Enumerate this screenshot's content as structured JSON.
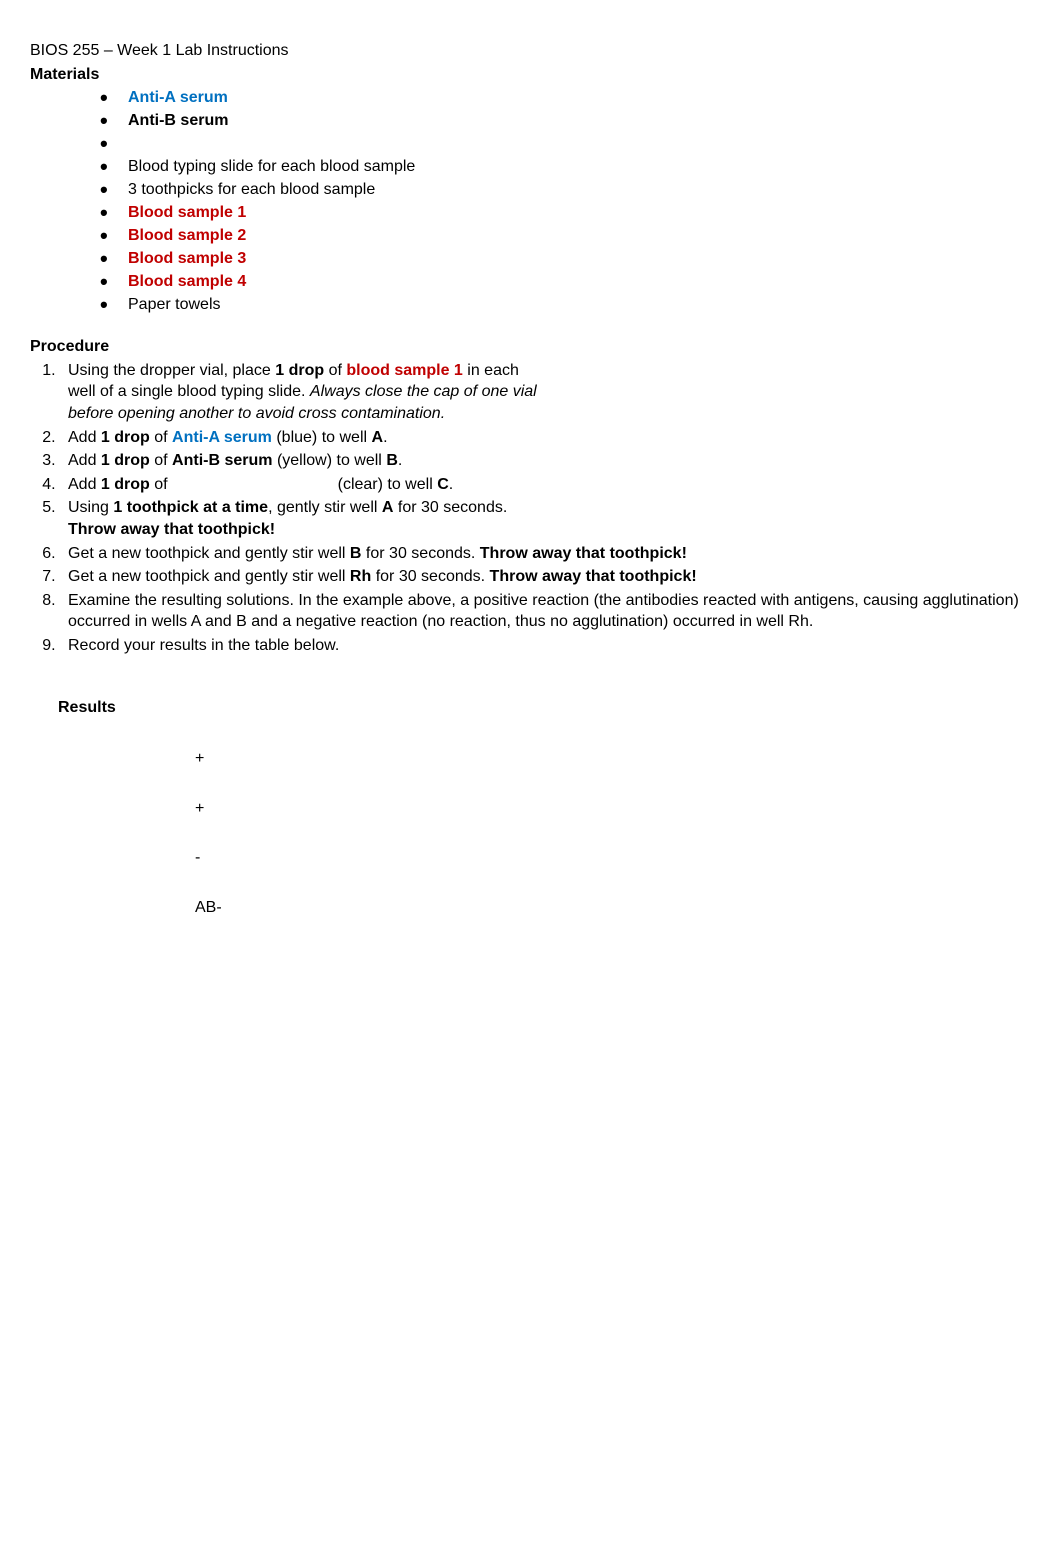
{
  "header": {
    "title": "BIOS 255 – Week 1 Lab Instructions"
  },
  "materials": {
    "heading": "Materials",
    "items": {
      "anti_a": "Anti-A serum",
      "anti_b": "Anti-B serum",
      "blank": "",
      "slide": "Blood typing slide for each blood sample",
      "toothpicks": "3 toothpicks for each blood sample",
      "bs1": "Blood sample 1",
      "bs2": "Blood sample 2",
      "bs3": "Blood sample 3",
      "bs4": "Blood sample 4",
      "towels": "Paper towels"
    }
  },
  "procedure": {
    "heading": "Procedure",
    "step1": {
      "p1": "Using the dropper vial, place ",
      "bold1": "1 drop",
      "p2": " of ",
      "red1": "blood sample 1",
      "p3": " in each well of a single blood typing slide. ",
      "italic1": "Always close the cap of one vial before opening another to avoid cross contamination."
    },
    "step2": {
      "p1": "Add ",
      "bold1": "1 drop",
      "p2": " of ",
      "colored1": "Anti-A serum",
      "p3": " (blue) to well ",
      "bold2": "A",
      "p4": "."
    },
    "step3": {
      "p1": "Add ",
      "bold1": "1 drop",
      "p2": " of ",
      "bold2": "Anti-B serum",
      "p3": " (yellow) to well ",
      "bold3": "B",
      "p4": "."
    },
    "step4": {
      "p1": "Add ",
      "bold1": "1 drop",
      "p2": " of",
      "p3": "(clear) to well ",
      "bold2": "C",
      "p4": "."
    },
    "step5": {
      "p1": "Using ",
      "bold1": "1 toothpick at a time",
      "p2": ", gently stir well ",
      "bold2": "A",
      "p3": " for 30 seconds. ",
      "bold3": "Throw away that toothpick!"
    },
    "step6": {
      "p1": "Get a new toothpick and gently stir well ",
      "bold1": "B",
      "p2": " for 30 seconds. ",
      "bold2": "Throw away that toothpick!"
    },
    "step7": {
      "p1": "Get a new toothpick and gently stir well ",
      "bold1": "Rh",
      "p2": " for 30 seconds. ",
      "bold2": "Throw away that toothpick!"
    },
    "step8": {
      "p1": "Examine the resulting solutions. In the example above, a positive reaction (the antibodies reacted with antigens, causing agglutination) occurred in wells A and B and a negative reaction (no reaction, thus no agglutination) occurred in well Rh."
    },
    "step9": {
      "p1": "Record your results in the table below."
    }
  },
  "results": {
    "heading": "Results",
    "rows": {
      "r1": "+",
      "r2": "+",
      "r3": "-",
      "r4": "AB-"
    }
  }
}
